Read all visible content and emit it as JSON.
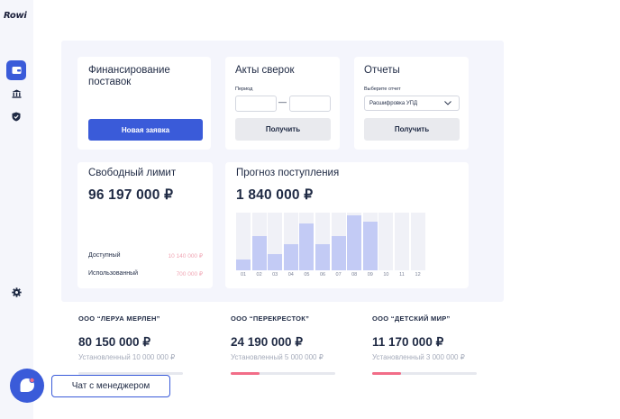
{
  "app": {
    "logo_text": "Rowi"
  },
  "sidebar": {
    "items": [
      {
        "icon": "wallet-icon",
        "active": true
      },
      {
        "icon": "bank-icon",
        "active": false
      },
      {
        "icon": "shield-check-icon",
        "active": false
      },
      {
        "icon": "gear-icon",
        "active": false
      }
    ]
  },
  "financing": {
    "title": "Финансирование поставок",
    "button_label": "Новая заявка"
  },
  "reconciliation": {
    "title": "Акты сверок",
    "period_label": "Период",
    "dash": "—",
    "button_label": "Получить"
  },
  "reports": {
    "title": "Отчеты",
    "select_label": "Выберите отчет",
    "select_value": "Расшифровка УПД",
    "button_label": "Получить"
  },
  "limit": {
    "title": "Свободный лимит",
    "amount": "96 197 000 ₽",
    "available_label": "Доступный",
    "available_value": "10 140 000 ₽",
    "used_label": "Использованный",
    "used_value": "700 000 ₽"
  },
  "forecast": {
    "title": "Прогноз поступления",
    "amount": "1 840 000 ₽"
  },
  "chart_data": {
    "type": "bar",
    "categories": [
      "01",
      "02",
      "03",
      "04",
      "05",
      "06",
      "07",
      "08",
      "09",
      "10",
      "11",
      "12"
    ],
    "values": [
      18,
      60,
      28,
      45,
      82,
      45,
      60,
      95,
      85,
      0,
      0,
      0
    ],
    "ylim": [
      0,
      100
    ],
    "title": "",
    "xlabel": "",
    "ylabel": "",
    "grid": false,
    "colors": {
      "bar": "#c3cbf5",
      "background_column": "#f0f1f7"
    }
  },
  "companies": [
    {
      "name": "ООО “ЛЕРУА МЕРЛЕН”",
      "amount": "80 150 000 ₽",
      "limit_text": "Установленный 10 000 000 ₽",
      "progress": 0
    },
    {
      "name": "ООО “ПЕРЕКРЕСТОК”",
      "amount": "24 190 000 ₽",
      "limit_text": "Установленный 5 000 000 ₽",
      "progress": 0.28
    },
    {
      "name": "ООО “ДЕТСКИЙ МИР”",
      "amount": "11 170 000 ₽",
      "limit_text": "Установленный 3 000 000 ₽",
      "progress": 0.28
    }
  ],
  "chat": {
    "label": "Чат с менеджером"
  },
  "colors": {
    "accent": "#3a5bd9",
    "danger": "#f26d88",
    "muted_pink": "#f0a5b3"
  }
}
